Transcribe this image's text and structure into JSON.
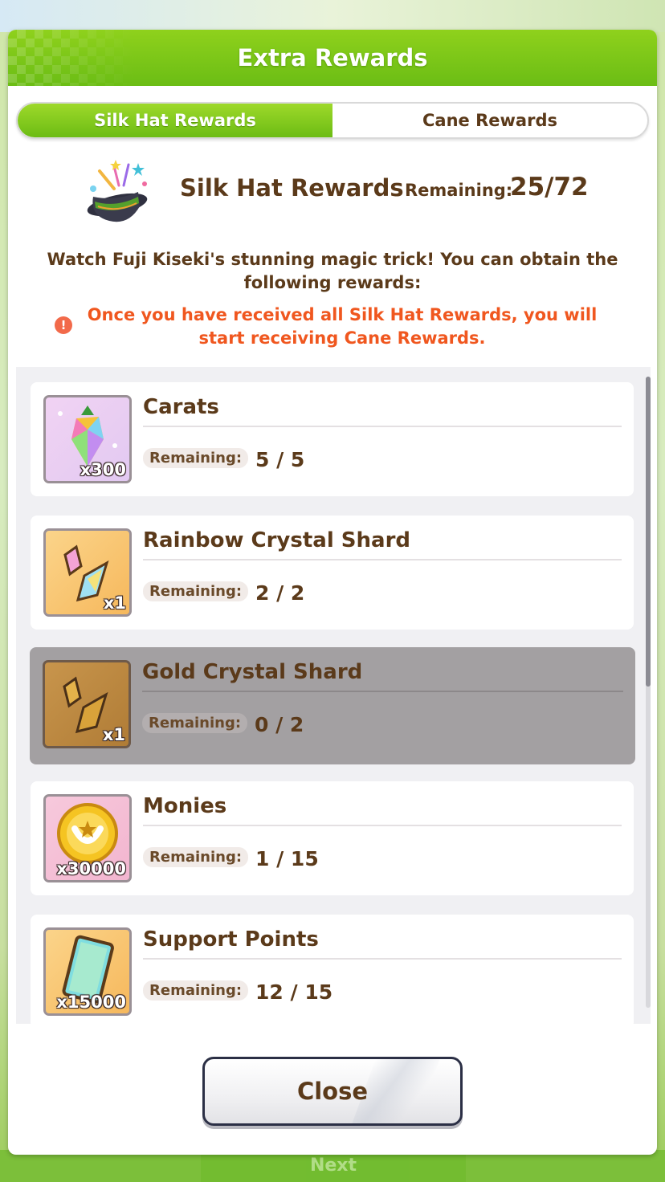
{
  "dialog": {
    "title": "Extra Rewards"
  },
  "tabs": [
    {
      "label": "Silk Hat Rewards",
      "active": true
    },
    {
      "label": "Cane Rewards",
      "active": false
    }
  ],
  "summary": {
    "icon": "silk-hat-icon",
    "title": "Silk Hat Rewards",
    "remaining_label": "Remaining:",
    "remaining_value": "25/72"
  },
  "description": "Watch Fuji Kiseki's stunning magic trick! You can obtain the following rewards:",
  "warning": {
    "icon": "alert-icon",
    "text": "Once you have received all Silk Hat Rewards, you will start receiving Cane Rewards."
  },
  "rewards": [
    {
      "name": "Carats",
      "quantity": "x300",
      "remaining_label": "Remaining:",
      "remaining": "5 / 5",
      "icon": "carats-icon",
      "depleted": false
    },
    {
      "name": "Rainbow Crystal Shard",
      "quantity": "x1",
      "remaining_label": "Remaining:",
      "remaining": "2 / 2",
      "icon": "rainbow-crystal-shard-icon",
      "depleted": false
    },
    {
      "name": "Gold Crystal Shard",
      "quantity": "x1",
      "remaining_label": "Remaining:",
      "remaining": "0 / 2",
      "icon": "gold-crystal-shard-icon",
      "depleted": true
    },
    {
      "name": "Monies",
      "quantity": "x30000",
      "remaining_label": "Remaining:",
      "remaining": "1 / 15",
      "icon": "monies-coin-icon",
      "depleted": false
    },
    {
      "name": "Support Points",
      "quantity": "x15000",
      "remaining_label": "Remaining:",
      "remaining": "12 / 15",
      "icon": "support-points-icon",
      "depleted": false
    }
  ],
  "close_label": "Close",
  "background_button_label": "Next",
  "colors": {
    "header_green": "#7cc618",
    "text_brown": "#5b3a1a",
    "warning_orange": "#f0571f",
    "depleted_gray": "#a3a0a2"
  }
}
